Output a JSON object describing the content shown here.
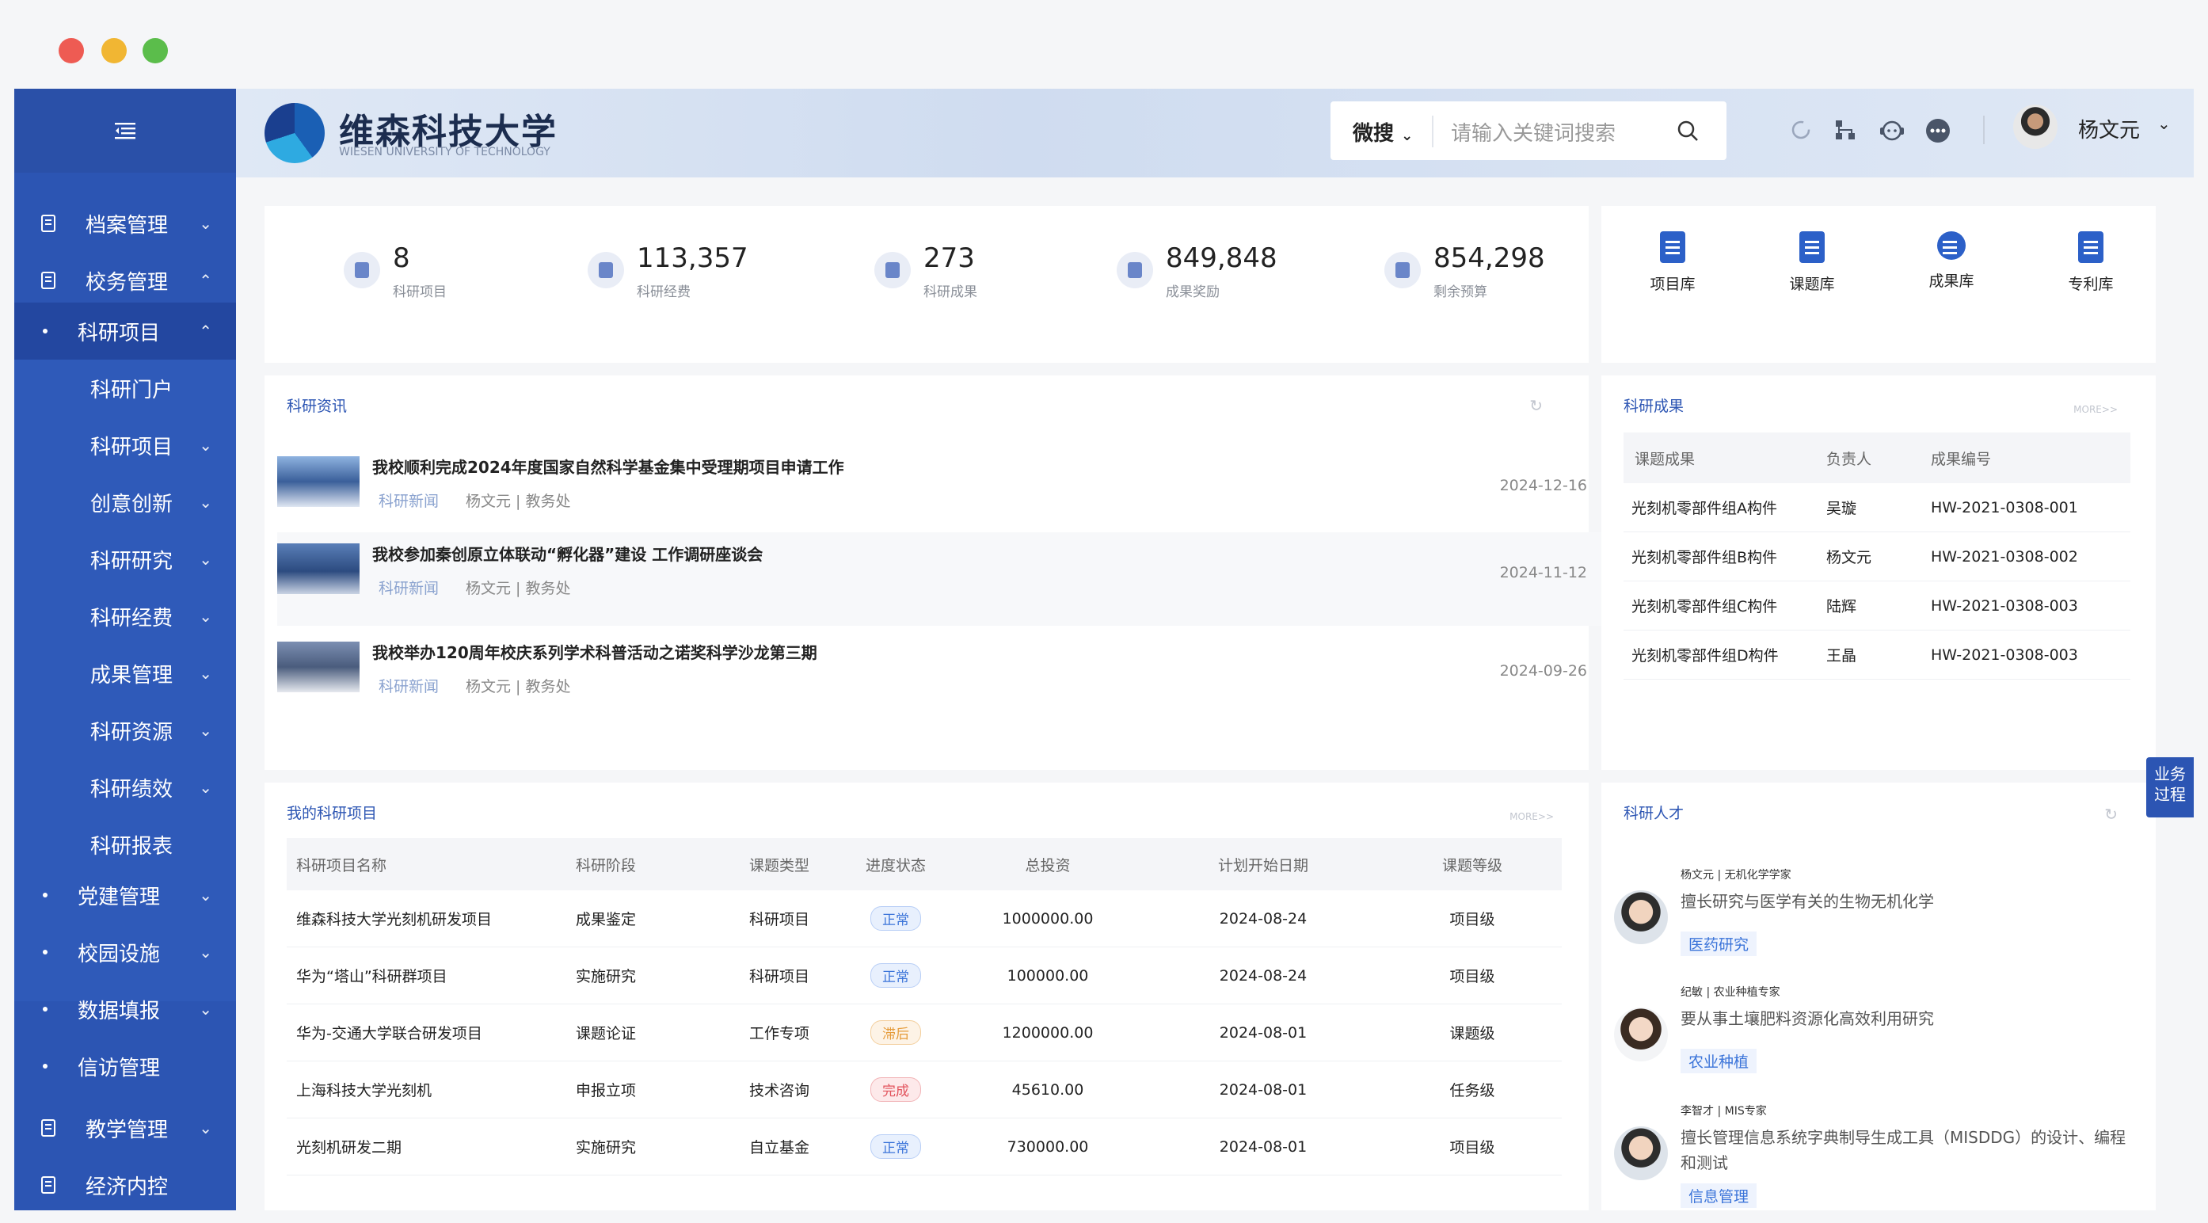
{
  "header": {
    "logo_title": "维森科技大学",
    "logo_subtitle": "WIESEN UNIVERSITY OF TECHNOLOGY",
    "search_scope": "微搜",
    "search_placeholder": "请输入关键词搜索",
    "user_name": "杨文元"
  },
  "sidebar": {
    "items": [
      {
        "label": "档案管理"
      },
      {
        "label": "校务管理"
      },
      {
        "label": "科研项目"
      },
      {
        "label": "科研门户"
      },
      {
        "label": "科研项目"
      },
      {
        "label": "创意创新"
      },
      {
        "label": "科研研究"
      },
      {
        "label": "科研经费"
      },
      {
        "label": "成果管理"
      },
      {
        "label": "科研资源"
      },
      {
        "label": "科研绩效"
      },
      {
        "label": "科研报表"
      },
      {
        "label": "党建管理"
      },
      {
        "label": "校园设施"
      },
      {
        "label": "数据填报"
      },
      {
        "label": "信访管理"
      },
      {
        "label": "教学管理"
      },
      {
        "label": "经济内控"
      }
    ]
  },
  "stats": [
    {
      "value": "8",
      "label": "科研项目"
    },
    {
      "value": "113,357",
      "label": "科研经费"
    },
    {
      "value": "273",
      "label": "科研成果"
    },
    {
      "value": "849,848",
      "label": "成果奖励"
    },
    {
      "value": "854,298",
      "label": "剩余预算"
    }
  ],
  "libraries": [
    {
      "label": "项目库"
    },
    {
      "label": "课题库"
    },
    {
      "label": "成果库"
    },
    {
      "label": "专利库"
    }
  ],
  "news": {
    "title": "科研资讯",
    "items": [
      {
        "title": "我校顺利完成2024年度国家自然科学基金集中受理期项目申请工作",
        "tag": "科研新闻",
        "author": "杨文元 | 教务处",
        "date": "2024-12-16"
      },
      {
        "title": "我校参加秦创原立体联动“孵化器”建设 工作调研座谈会",
        "tag": "科研新闻",
        "author": "杨文元 | 教务处",
        "date": "2024-11-12"
      },
      {
        "title": "我校举办120周年校庆系列学术科普活动之诺奖科学沙龙第三期",
        "tag": "科研新闻",
        "author": "杨文元 | 教务处",
        "date": "2024-09-26"
      }
    ]
  },
  "results": {
    "title": "科研成果",
    "more": "MORE>>",
    "columns": [
      "课题成果",
      "负责人",
      "成果编号"
    ],
    "rows": [
      [
        "光刻机零部件组A构件",
        "吴璇",
        "HW-2021-0308-001"
      ],
      [
        "光刻机零部件组B构件",
        "杨文元",
        "HW-2021-0308-002"
      ],
      [
        "光刻机零部件组C构件",
        "陆辉",
        "HW-2021-0308-003"
      ],
      [
        "光刻机零部件组D构件",
        "王晶",
        "HW-2021-0308-003"
      ]
    ]
  },
  "projects": {
    "title": "我的科研项目",
    "more": "MORE>>",
    "columns": [
      "科研项目名称",
      "科研阶段",
      "课题类型",
      "进度状态",
      "总投资",
      "计划开始日期",
      "课题等级"
    ],
    "rows": [
      [
        "维森科技大学光刻机研发项目",
        "成果鉴定",
        "科研项目",
        "正常",
        "1000000.00",
        "2024-08-24",
        "项目级"
      ],
      [
        "华为“塔山”科研群项目",
        "实施研究",
        "科研项目",
        "正常",
        "100000.00",
        "2024-08-24",
        "项目级"
      ],
      [
        "华为-交通大学联合研发项目",
        "课题论证",
        "工作专项",
        "滞后",
        "1200000.00",
        "2024-08-01",
        "课题级"
      ],
      [
        "上海科技大学光刻机",
        "申报立项",
        "技术咨询",
        "完成",
        "45610.00",
        "2024-08-01",
        "任务级"
      ],
      [
        "光刻机研发二期",
        "实施研究",
        "自立基金",
        "正常",
        "730000.00",
        "2024-08-01",
        "项目级"
      ]
    ],
    "status_colors": {
      "正常": "#3b74d9",
      "滞后": "#e59b3a",
      "完成": "#e2535c"
    }
  },
  "talent": {
    "title": "科研人才",
    "items": [
      {
        "name": "杨文元 | 无机化学学家",
        "desc": "擅长研究与医学有关的生物无机化学",
        "tag": "医药研究"
      },
      {
        "name": "纪敏 | 农业种植专家",
        "desc": "要从事土壤肥料资源化高效利用研究",
        "tag": "农业种植"
      },
      {
        "name": "李智才 | MIS专家",
        "desc": "擅长管理信息系统字典制导生成工具（MISDDG）的设计、编程和测试",
        "tag": "信息管理"
      }
    ]
  },
  "float_tab": {
    "label": "业务过程"
  },
  "theme": {
    "primary": "#2c55b3",
    "background": "#f5f6f8"
  }
}
